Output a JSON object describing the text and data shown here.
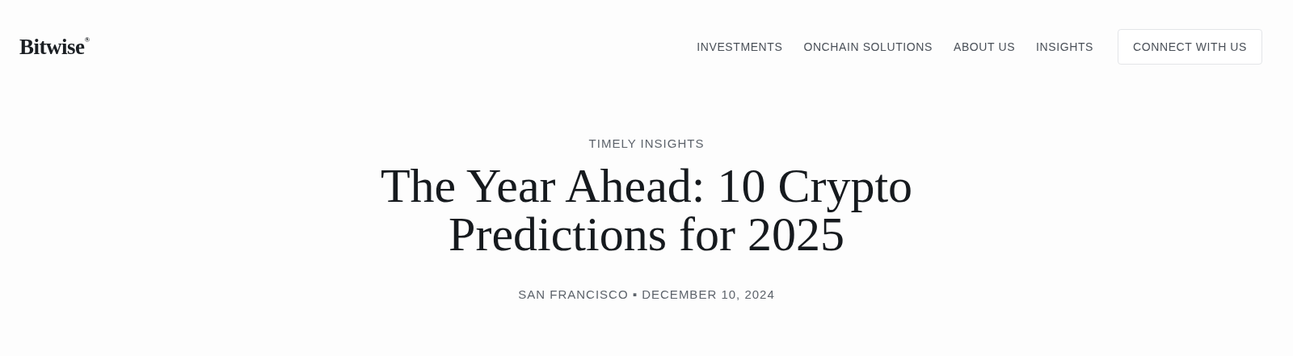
{
  "header": {
    "logo": "Bitwise$^{®}$",
    "nav": [
      "INVESTMENTS",
      "ONCHAIN SOLUTIONS",
      "ABOUT US",
      "INSIGHTS"
    ],
    "cta": "CONNECT WITH US"
  },
  "article": {
    "category": "TIMELY INSIGHTS",
    "title_lines": [
      "The Year Ahead: 10 Crypto",
      "Predictions for 2025"
    ],
    "byline": "SAN FRANCISCO ▪ DECEMBER 10, 2024"
  }
}
